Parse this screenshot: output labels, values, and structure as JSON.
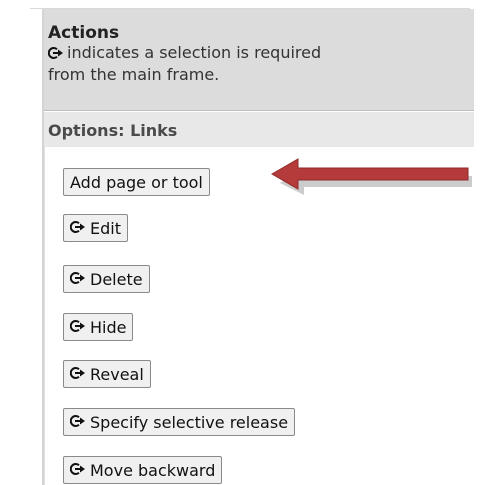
{
  "actions": {
    "title": "Actions",
    "description_line1": "indicates a selection is required",
    "description_line2": "from the main frame."
  },
  "options": {
    "title": "Options: Links"
  },
  "buttons": {
    "add_page": "Add page or tool",
    "edit": "Edit",
    "delete": "Delete",
    "hide": "Hide",
    "reveal": "Reveal",
    "selective_release": "Specify selective release",
    "move_backward": "Move backward"
  },
  "icons": {
    "selection_required": "selection-required-icon",
    "annotation_arrow": "red-arrow-icon"
  },
  "colors": {
    "arrow": "#b53a3a",
    "panel_header": "#dcdcdc",
    "options_header": "#e8e8e8"
  }
}
